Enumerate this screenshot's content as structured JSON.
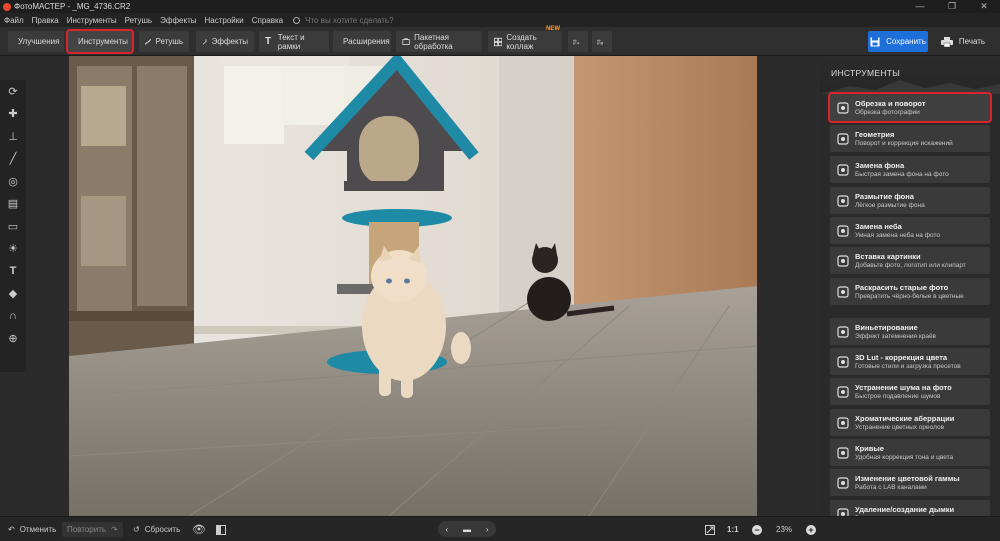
{
  "window": {
    "title": "ФотоМАСТЕР - _MG_4736.CR2",
    "controls": [
      "—",
      "❐",
      "✕"
    ]
  },
  "menu": {
    "items": [
      "Файл",
      "Правка",
      "Инструменты",
      "Ретушь",
      "Эффекты",
      "Настройки",
      "Справка"
    ],
    "search_placeholder": "Что вы хотите сделать?"
  },
  "toolbar": {
    "buttons": [
      {
        "label": "Улучшения",
        "icon": "sliders-icon"
      },
      {
        "label": "Инструменты",
        "icon": "crop-icon",
        "active": true
      },
      {
        "label": "Ретушь",
        "icon": "brush-icon"
      },
      {
        "label": "Эффекты",
        "icon": "magic-wand-icon"
      },
      {
        "label": "Текст и рамки",
        "icon": "text-icon"
      },
      {
        "label": "Расширения",
        "icon": "plus-icon"
      },
      {
        "label": "Пакетная обработка",
        "icon": "batch-icon"
      },
      {
        "label": "Создать коллаж",
        "icon": "collage-icon",
        "badge": "NEW"
      }
    ],
    "save_label": "Сохранить",
    "print_label": "Печать"
  },
  "left_tools": [
    "rotate-icon",
    "bandage-icon",
    "stamp-icon",
    "brush-icon",
    "radial-icon",
    "gradient-icon",
    "vignette-icon",
    "sun-icon",
    "text-icon",
    "fill-icon",
    "magnet-icon",
    "globe-icon"
  ],
  "panel": {
    "title": "ИНСТРУМЕНТЫ",
    "tools": [
      {
        "title": "Обрезка и поворот",
        "subtitle": "Обрезка фотографии",
        "icon": "crop-rotate-icon",
        "active": true
      },
      {
        "title": "Геометрия",
        "subtitle": "Поворот и коррекция искажений",
        "icon": "geometry-icon"
      },
      {
        "title": "Замена фона",
        "subtitle": "Быстрая замена фона на фото",
        "icon": "background-icon"
      },
      {
        "title": "Размытие фона",
        "subtitle": "Лёгкое размытие фона",
        "icon": "blur-icon"
      },
      {
        "title": "Замена неба",
        "subtitle": "Умная замена неба на фото",
        "icon": "sky-icon"
      },
      {
        "title": "Вставка картинки",
        "subtitle": "Добавьте фото, логотип или клипарт",
        "icon": "insert-image-icon"
      },
      {
        "title": "Раскрасить старые фото",
        "subtitle": "Превратить чёрно-белые в цветные",
        "icon": "colorize-icon"
      },
      {
        "title": "Виньетирование",
        "subtitle": "Эффект затемнения краёв",
        "icon": "vignette-icon"
      },
      {
        "title": "3D Lut - коррекция цвета",
        "subtitle": "Готовые стили и загрузка пресетов",
        "icon": "lut-icon"
      },
      {
        "title": "Устранение шума на фото",
        "subtitle": "Быстрое подавление шумов",
        "icon": "noise-icon"
      },
      {
        "title": "Хроматические аберрации",
        "subtitle": "Устранение цветных ореолов",
        "icon": "aberration-icon"
      },
      {
        "title": "Кривые",
        "subtitle": "Удобная коррекция тона и цвета",
        "icon": "curves-icon"
      },
      {
        "title": "Изменение цветовой гаммы",
        "subtitle": "Работа с LAB каналами",
        "icon": "color-gamut-icon"
      },
      {
        "title": "Удаление/создание дымки",
        "subtitle": "Верните контраст или добавьте туман",
        "icon": "haze-icon"
      }
    ]
  },
  "bottom": {
    "undo_label": "Отменить",
    "redo_label": "Повторить",
    "reset_label": "Сбросить",
    "ratio_label": "1:1",
    "zoom_value": "23%"
  },
  "colors": {
    "accent": "#1e6fd9",
    "highlight": "#d9232b",
    "badge": "#ff9b2e"
  }
}
